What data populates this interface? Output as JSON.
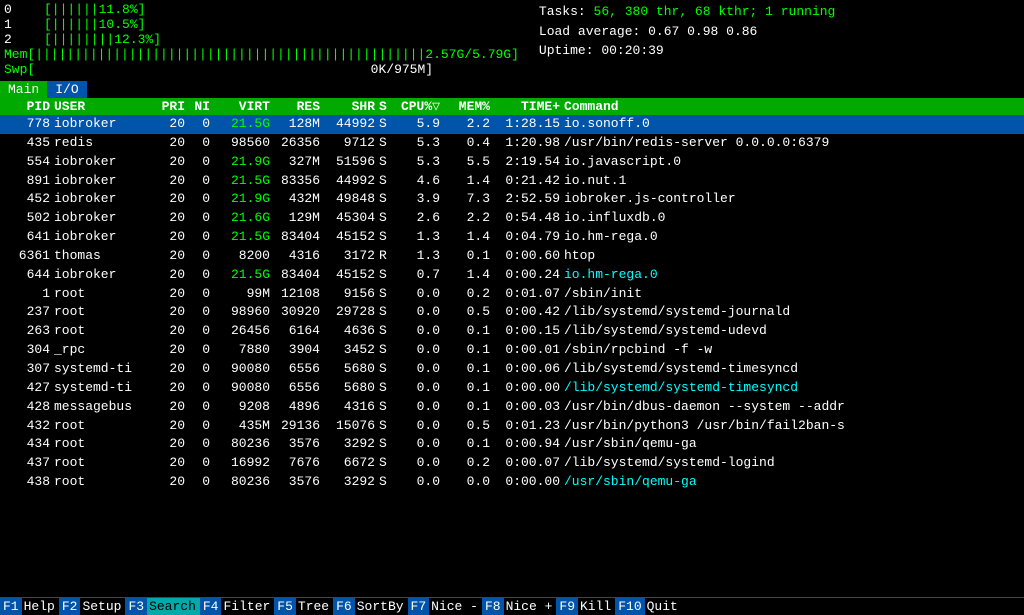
{
  "cpu_rows": [
    {
      "label": "0",
      "bar": "[||||||",
      "pct": "11.8%]"
    },
    {
      "label": "1",
      "bar": "[||||||",
      "pct": "10.5%]"
    },
    {
      "label": "2",
      "bar": "[||||||||",
      "pct": "12.3%]"
    }
  ],
  "mem_row": {
    "label": "Mem",
    "bar": "[||||||||||||||||||||||||||||||||||||||||||||||||||",
    "values": "2.57G/5.79G]"
  },
  "swp_row": {
    "label": "Swp",
    "bar": "[",
    "values": "0K/975M]"
  },
  "stats": {
    "tasks_label": "Tasks:",
    "tasks_val": "56,",
    "thr_val": "380 thr,",
    "kthr_val": "68 kthr;",
    "running_val": "1 running",
    "load_label": "Load average:",
    "load_vals": "0.67 0.98 0.86",
    "uptime_label": "Uptime:",
    "uptime_val": "00:20:39"
  },
  "tabs": [
    {
      "label": "Main",
      "active": true
    },
    {
      "label": "I/O",
      "active": false
    }
  ],
  "table_header": {
    "pid": "PID",
    "user": "USER",
    "pri": "PRI",
    "ni": "NI",
    "virt": "VIRT",
    "res": "RES",
    "shr": "SHR",
    "s": "S",
    "cpu": "CPU%▽",
    "mem": "MEM%",
    "time": "TIME+",
    "cmd": "Command"
  },
  "processes": [
    {
      "pid": "778",
      "user": "iobroker",
      "pri": "20",
      "ni": "0",
      "virt": "21.5G",
      "res": "128M",
      "shr": "44992",
      "s": "S",
      "cpu": "5.9",
      "mem": "2.2",
      "time": "1:28.15",
      "cmd": "io.sonoff.0",
      "selected": true,
      "virt_green": true,
      "cmd_color": "white"
    },
    {
      "pid": "435",
      "user": "redis",
      "pri": "20",
      "ni": "0",
      "virt": "98560",
      "res": "26356",
      "shr": "9712",
      "s": "S",
      "cpu": "5.3",
      "mem": "0.4",
      "time": "1:20.98",
      "cmd": "/usr/bin/redis-server 0.0.0.0:6379",
      "selected": false,
      "virt_green": false,
      "cmd_color": "white"
    },
    {
      "pid": "554",
      "user": "iobroker",
      "pri": "20",
      "ni": "0",
      "virt": "21.9G",
      "res": "327M",
      "shr": "51596",
      "s": "S",
      "cpu": "5.3",
      "mem": "5.5",
      "time": "2:19.54",
      "cmd": "io.javascript.0",
      "selected": false,
      "virt_green": true,
      "cmd_color": "white"
    },
    {
      "pid": "891",
      "user": "iobroker",
      "pri": "20",
      "ni": "0",
      "virt": "21.5G",
      "res": "83356",
      "shr": "44992",
      "s": "S",
      "cpu": "4.6",
      "mem": "1.4",
      "time": "0:21.42",
      "cmd": "io.nut.1",
      "selected": false,
      "virt_green": true,
      "cmd_color": "white"
    },
    {
      "pid": "452",
      "user": "iobroker",
      "pri": "20",
      "ni": "0",
      "virt": "21.9G",
      "res": "432M",
      "shr": "49848",
      "s": "S",
      "cpu": "3.9",
      "mem": "7.3",
      "time": "2:52.59",
      "cmd": "iobroker.js-controller",
      "selected": false,
      "virt_green": true,
      "cmd_color": "white"
    },
    {
      "pid": "502",
      "user": "iobroker",
      "pri": "20",
      "ni": "0",
      "virt": "21.6G",
      "res": "129M",
      "shr": "45304",
      "s": "S",
      "cpu": "2.6",
      "mem": "2.2",
      "time": "0:54.48",
      "cmd": "io.influxdb.0",
      "selected": false,
      "virt_green": true,
      "cmd_color": "white"
    },
    {
      "pid": "641",
      "user": "iobroker",
      "pri": "20",
      "ni": "0",
      "virt": "21.5G",
      "res": "83404",
      "shr": "45152",
      "s": "S",
      "cpu": "1.3",
      "mem": "1.4",
      "time": "0:04.79",
      "cmd": "io.hm-rega.0",
      "selected": false,
      "virt_green": true,
      "cmd_color": "white"
    },
    {
      "pid": "6361",
      "user": "thomas",
      "pri": "20",
      "ni": "0",
      "virt": "8200",
      "res": "4316",
      "shr": "3172",
      "s": "R",
      "cpu": "1.3",
      "mem": "0.1",
      "time": "0:00.60",
      "cmd": "htop",
      "selected": false,
      "virt_green": false,
      "cmd_color": "white"
    },
    {
      "pid": "644",
      "user": "iobroker",
      "pri": "20",
      "ni": "0",
      "virt": "21.5G",
      "res": "83404",
      "shr": "45152",
      "s": "S",
      "cpu": "0.7",
      "mem": "1.4",
      "time": "0:00.24",
      "cmd": "io.hm-rega.0",
      "selected": false,
      "virt_green": true,
      "cmd_color": "cyan"
    },
    {
      "pid": "1",
      "user": "root",
      "pri": "20",
      "ni": "0",
      "virt": "99M",
      "res": "12108",
      "shr": "9156",
      "s": "S",
      "cpu": "0.0",
      "mem": "0.2",
      "time": "0:01.07",
      "cmd": "/sbin/init",
      "selected": false,
      "virt_green": false,
      "cmd_color": "white"
    },
    {
      "pid": "237",
      "user": "root",
      "pri": "20",
      "ni": "0",
      "virt": "98960",
      "res": "30920",
      "shr": "29728",
      "s": "S",
      "cpu": "0.0",
      "mem": "0.5",
      "time": "0:00.42",
      "cmd": "/lib/systemd/systemd-journald",
      "selected": false,
      "virt_green": false,
      "cmd_color": "white"
    },
    {
      "pid": "263",
      "user": "root",
      "pri": "20",
      "ni": "0",
      "virt": "26456",
      "res": "6164",
      "shr": "4636",
      "s": "S",
      "cpu": "0.0",
      "mem": "0.1",
      "time": "0:00.15",
      "cmd": "/lib/systemd/systemd-udevd",
      "selected": false,
      "virt_green": false,
      "cmd_color": "white"
    },
    {
      "pid": "304",
      "user": "_rpc",
      "pri": "20",
      "ni": "0",
      "virt": "7880",
      "res": "3904",
      "shr": "3452",
      "s": "S",
      "cpu": "0.0",
      "mem": "0.1",
      "time": "0:00.01",
      "cmd": "/sbin/rpcbind -f -w",
      "selected": false,
      "virt_green": false,
      "cmd_color": "white"
    },
    {
      "pid": "307",
      "user": "systemd-ti",
      "pri": "20",
      "ni": "0",
      "virt": "90080",
      "res": "6556",
      "shr": "5680",
      "s": "S",
      "cpu": "0.0",
      "mem": "0.1",
      "time": "0:00.06",
      "cmd": "/lib/systemd/systemd-timesyncd",
      "selected": false,
      "virt_green": false,
      "cmd_color": "white"
    },
    {
      "pid": "427",
      "user": "systemd-ti",
      "pri": "20",
      "ni": "0",
      "virt": "90080",
      "res": "6556",
      "shr": "5680",
      "s": "S",
      "cpu": "0.0",
      "mem": "0.1",
      "time": "0:00.00",
      "cmd": "/lib/systemd/systemd-timesyncd",
      "selected": false,
      "virt_green": false,
      "cmd_color": "cyan"
    },
    {
      "pid": "428",
      "user": "messagebus",
      "pri": "20",
      "ni": "0",
      "virt": "9208",
      "res": "4896",
      "shr": "4316",
      "s": "S",
      "cpu": "0.0",
      "mem": "0.1",
      "time": "0:00.03",
      "cmd": "/usr/bin/dbus-daemon --system --addr",
      "selected": false,
      "virt_green": false,
      "cmd_color": "white"
    },
    {
      "pid": "432",
      "user": "root",
      "pri": "20",
      "ni": "0",
      "virt": "435M",
      "res": "29136",
      "shr": "15076",
      "s": "S",
      "cpu": "0.0",
      "mem": "0.5",
      "time": "0:01.23",
      "cmd": "/usr/bin/python3 /usr/bin/fail2ban-s",
      "selected": false,
      "virt_green": false,
      "cmd_color": "white"
    },
    {
      "pid": "434",
      "user": "root",
      "pri": "20",
      "ni": "0",
      "virt": "80236",
      "res": "3576",
      "shr": "3292",
      "s": "S",
      "cpu": "0.0",
      "mem": "0.1",
      "time": "0:00.94",
      "cmd": "/usr/sbin/qemu-ga",
      "selected": false,
      "virt_green": false,
      "cmd_color": "white"
    },
    {
      "pid": "437",
      "user": "root",
      "pri": "20",
      "ni": "0",
      "virt": "16992",
      "res": "7676",
      "shr": "6672",
      "s": "S",
      "cpu": "0.0",
      "mem": "0.2",
      "time": "0:00.07",
      "cmd": "/lib/systemd/systemd-logind",
      "selected": false,
      "virt_green": false,
      "cmd_color": "white"
    },
    {
      "pid": "438",
      "user": "root",
      "pri": "20",
      "ni": "0",
      "virt": "80236",
      "res": "3576",
      "shr": "3292",
      "s": "S",
      "cpu": "0.0",
      "mem": "0.0",
      "time": "0:00.00",
      "cmd": "/usr/sbin/qemu-ga",
      "selected": false,
      "virt_green": false,
      "cmd_color": "cyan"
    }
  ],
  "footer": [
    {
      "key": "F1",
      "label": "Help",
      "active": false
    },
    {
      "key": "F2",
      "label": "Setup",
      "active": false
    },
    {
      "key": "F3",
      "label": "Search",
      "active": true
    },
    {
      "key": "F4",
      "label": "Filter",
      "active": false
    },
    {
      "key": "F5",
      "label": "Tree",
      "active": false
    },
    {
      "key": "F6",
      "label": "SortBy",
      "active": false
    },
    {
      "key": "F7",
      "label": "Nice -",
      "active": false
    },
    {
      "key": "F8",
      "label": "Nice +",
      "active": false
    },
    {
      "key": "F9",
      "label": "Kill",
      "active": false
    },
    {
      "key": "F10",
      "label": "Quit",
      "active": false
    }
  ]
}
